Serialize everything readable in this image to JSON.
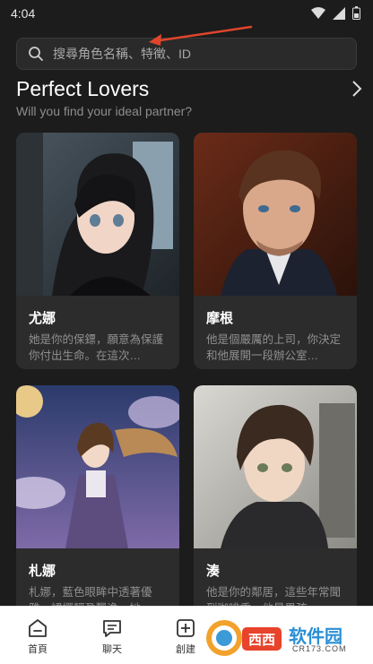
{
  "status": {
    "time": "4:04"
  },
  "search": {
    "placeholder": "搜尋角色名稱、特徵、ID"
  },
  "section": {
    "title": "Perfect Lovers",
    "subtitle": "Will you find your ideal partner?"
  },
  "cards": [
    {
      "name": "尤娜",
      "desc": "她是你的保鏢，願意為保護你付出生命。在這次…"
    },
    {
      "name": "摩根",
      "desc": "他是個嚴厲的上司，你決定和他展開一段辦公室…"
    },
    {
      "name": "札娜",
      "desc": "札娜，藍色眼眸中透著優雅，裙擺輕盈飄逸，她…"
    },
    {
      "name": "湊",
      "desc": "他是你的鄰居，這些年常聞到咖啡香，他是男孩，…"
    }
  ],
  "nav": {
    "items": [
      {
        "label": "首頁",
        "icon": "home-icon"
      },
      {
        "label": "聊天",
        "icon": "chat-icon"
      },
      {
        "label": "創建",
        "icon": "create-icon"
      }
    ]
  },
  "watermark": {
    "text": "软件园",
    "sub": "CR173.COM"
  },
  "colors": {
    "background": "#1c1c1c",
    "card": "#2c2c2c",
    "accent_arrow": "#e0452b"
  }
}
